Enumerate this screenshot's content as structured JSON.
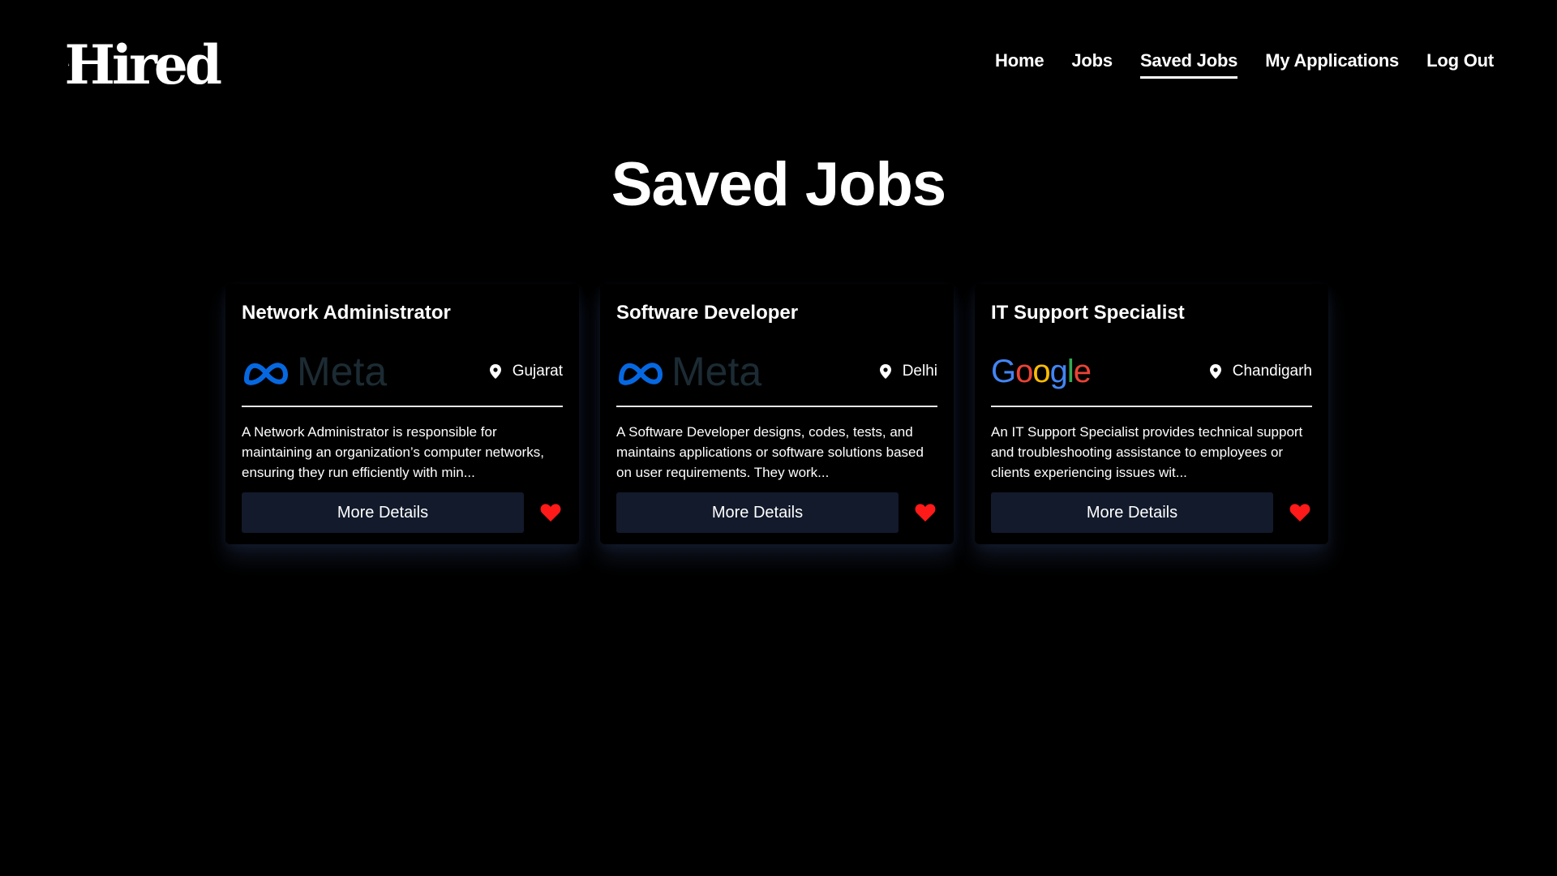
{
  "brand": {
    "name": "Hired"
  },
  "nav": {
    "items": [
      {
        "label": "Home",
        "active": false
      },
      {
        "label": "Jobs",
        "active": false
      },
      {
        "label": "Saved Jobs",
        "active": true
      },
      {
        "label": "My Applications",
        "active": false
      },
      {
        "label": "Log Out",
        "active": false
      }
    ]
  },
  "page": {
    "title": "Saved Jobs"
  },
  "jobs": [
    {
      "title": "Network Administrator",
      "company": "Meta",
      "location": "Gujarat",
      "description": "A Network Administrator is responsible for maintaining an organization’s computer networks, ensuring they run efficiently with min...",
      "button_label": "More Details",
      "saved": true
    },
    {
      "title": "Software Developer",
      "company": "Meta",
      "location": "Delhi",
      "description": "A Software Developer designs, codes, tests, and maintains applications or software solutions based on user requirements. They work...",
      "button_label": "More Details",
      "saved": true
    },
    {
      "title": "IT Support Specialist",
      "company": "Google",
      "location": "Chandigarh",
      "description": "An IT Support Specialist provides technical support and troubleshooting assistance to employees or clients experiencing issues wit...",
      "button_label": "More Details",
      "saved": true
    }
  ],
  "colors": {
    "background": "#000000",
    "button_bg": "#121a2b",
    "heart": "#ff1a1a",
    "meta_blue": "#0668e1"
  },
  "icons": {
    "location": "map-pin-icon",
    "saved": "heart-icon"
  }
}
